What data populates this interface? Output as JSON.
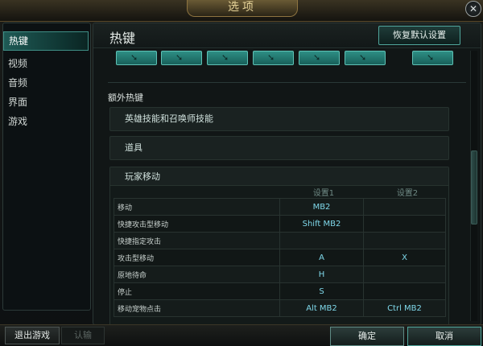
{
  "window": {
    "title": "选项",
    "close_icon": "close-icon",
    "close_glyph": "✕"
  },
  "sidebar": {
    "items": [
      {
        "label": "热键",
        "active": true
      },
      {
        "label": "视频",
        "active": false
      },
      {
        "label": "音频",
        "active": false
      },
      {
        "label": "界面",
        "active": false
      },
      {
        "label": "游戏",
        "active": false
      }
    ]
  },
  "main": {
    "title": "热键",
    "reset_button": "恢复默认设置",
    "keycap_glyph": "➘",
    "section_title": "额外热键",
    "groups": [
      {
        "label": "英雄技能和召唤师技能"
      },
      {
        "label": "道具"
      }
    ],
    "expanded_group": {
      "label": "玩家移动",
      "columns": [
        "设置1",
        "设置2"
      ],
      "rows": [
        {
          "action": "移动",
          "s1": "MB2",
          "s2": ""
        },
        {
          "action": "快捷攻击型移动",
          "s1": "Shift  MB2",
          "s2": ""
        },
        {
          "action": "快捷指定攻击",
          "s1": "",
          "s2": ""
        },
        {
          "action": "攻击型移动",
          "s1": "A",
          "s2": "X"
        },
        {
          "action": "原地待命",
          "s1": "H",
          "s2": ""
        },
        {
          "action": "停止",
          "s1": "S",
          "s2": ""
        },
        {
          "action": "移动宠物点击",
          "s1": "Alt  MB2",
          "s2": "Ctrl  MB2"
        }
      ]
    }
  },
  "footer": {
    "quit_button": "退出游戏",
    "surrender_button": "认输",
    "ok_button": "确定",
    "cancel_button": "取消"
  },
  "colors": {
    "accent": "#2e8e84",
    "binding_text": "#7fd8ea",
    "title_gold": "#e8d59a"
  }
}
